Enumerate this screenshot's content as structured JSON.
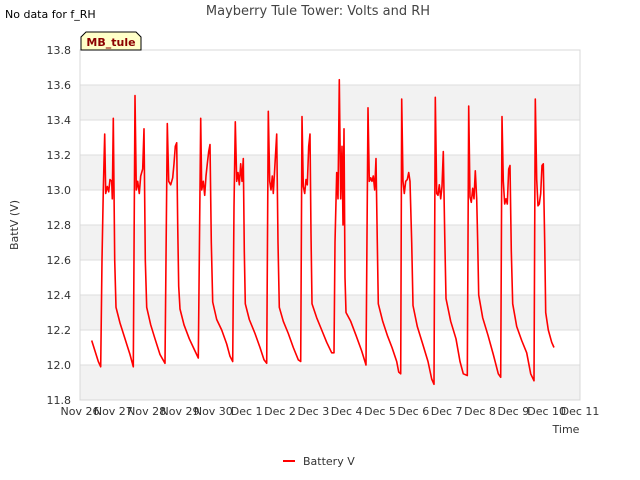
{
  "note": "No data for f_RH",
  "badge": "MB_tule",
  "colors": {
    "series": "#ff0000",
    "badge_fill": "#ffffc8",
    "band": "#f2f2f2"
  },
  "chart_data": {
    "type": "line",
    "title": "Mayberry Tule Tower: Volts and RH",
    "xlabel": "Time",
    "ylabel": "BattV (V)",
    "ylim": [
      11.8,
      13.8
    ],
    "xlim": [
      0,
      15
    ],
    "x_ticks": [
      {
        "x": 0,
        "label": "Nov 26"
      },
      {
        "x": 1,
        "label": "Nov 27"
      },
      {
        "x": 2,
        "label": "Nov 28"
      },
      {
        "x": 3,
        "label": "Nov 29"
      },
      {
        "x": 4,
        "label": "Nov 30"
      },
      {
        "x": 5,
        "label": "Dec 1"
      },
      {
        "x": 6,
        "label": "Dec 2"
      },
      {
        "x": 7,
        "label": "Dec 3"
      },
      {
        "x": 8,
        "label": "Dec 4"
      },
      {
        "x": 9,
        "label": "Dec 5"
      },
      {
        "x": 10,
        "label": "Dec 6"
      },
      {
        "x": 11,
        "label": "Dec 7"
      },
      {
        "x": 12,
        "label": "Dec 8"
      },
      {
        "x": 13,
        "label": "Dec 9"
      },
      {
        "x": 14,
        "label": "Dec 10"
      },
      {
        "x": 15,
        "label": "Dec 11"
      }
    ],
    "y_ticks": [
      11.8,
      12.0,
      12.2,
      12.4,
      12.6,
      12.8,
      13.0,
      13.2,
      13.4,
      13.6,
      13.8
    ],
    "legend": "bottom-center",
    "series": [
      {
        "name": "Battery V",
        "color": "#ff0000",
        "points": [
          [
            0.35,
            12.14
          ],
          [
            0.45,
            12.08
          ],
          [
            0.55,
            12.02
          ],
          [
            0.62,
            11.99
          ],
          [
            0.66,
            12.6
          ],
          [
            0.7,
            13.0
          ],
          [
            0.74,
            13.32
          ],
          [
            0.77,
            12.98
          ],
          [
            0.82,
            13.02
          ],
          [
            0.86,
            12.99
          ],
          [
            0.9,
            13.06
          ],
          [
            0.95,
            13.05
          ],
          [
            0.97,
            12.95
          ],
          [
            1.0,
            13.41
          ],
          [
            1.04,
            12.6
          ],
          [
            1.08,
            12.33
          ],
          [
            1.2,
            12.24
          ],
          [
            1.35,
            12.15
          ],
          [
            1.5,
            12.06
          ],
          [
            1.6,
            11.99
          ],
          [
            1.65,
            13.54
          ],
          [
            1.69,
            13.0
          ],
          [
            1.73,
            13.05
          ],
          [
            1.78,
            12.98
          ],
          [
            1.82,
            13.08
          ],
          [
            1.88,
            13.12
          ],
          [
            1.92,
            13.35
          ],
          [
            1.96,
            12.6
          ],
          [
            2.0,
            12.33
          ],
          [
            2.12,
            12.23
          ],
          [
            2.25,
            12.15
          ],
          [
            2.4,
            12.06
          ],
          [
            2.55,
            12.01
          ],
          [
            2.62,
            13.38
          ],
          [
            2.66,
            13.05
          ],
          [
            2.72,
            13.03
          ],
          [
            2.78,
            13.07
          ],
          [
            2.82,
            13.15
          ],
          [
            2.86,
            13.25
          ],
          [
            2.9,
            13.27
          ],
          [
            2.93,
            12.8
          ],
          [
            2.96,
            12.45
          ],
          [
            3.0,
            12.32
          ],
          [
            3.12,
            12.23
          ],
          [
            3.28,
            12.15
          ],
          [
            3.45,
            12.08
          ],
          [
            3.55,
            12.04
          ],
          [
            3.62,
            13.41
          ],
          [
            3.65,
            13.0
          ],
          [
            3.7,
            13.05
          ],
          [
            3.74,
            12.97
          ],
          [
            3.78,
            13.08
          ],
          [
            3.82,
            13.15
          ],
          [
            3.86,
            13.22
          ],
          [
            3.9,
            13.26
          ],
          [
            3.94,
            12.7
          ],
          [
            3.98,
            12.36
          ],
          [
            4.1,
            12.26
          ],
          [
            4.25,
            12.2
          ],
          [
            4.4,
            12.12
          ],
          [
            4.5,
            12.05
          ],
          [
            4.58,
            12.02
          ],
          [
            4.62,
            12.9
          ],
          [
            4.66,
            13.39
          ],
          [
            4.7,
            13.05
          ],
          [
            4.74,
            13.1
          ],
          [
            4.78,
            13.03
          ],
          [
            4.82,
            13.15
          ],
          [
            4.86,
            13.05
          ],
          [
            4.9,
            13.18
          ],
          [
            4.93,
            12.65
          ],
          [
            4.96,
            12.35
          ],
          [
            5.08,
            12.26
          ],
          [
            5.25,
            12.18
          ],
          [
            5.4,
            12.1
          ],
          [
            5.52,
            12.03
          ],
          [
            5.6,
            12.01
          ],
          [
            5.65,
            13.45
          ],
          [
            5.69,
            13.05
          ],
          [
            5.73,
            13.0
          ],
          [
            5.77,
            13.08
          ],
          [
            5.8,
            12.98
          ],
          [
            5.85,
            13.15
          ],
          [
            5.9,
            13.32
          ],
          [
            5.94,
            12.7
          ],
          [
            5.98,
            12.33
          ],
          [
            6.1,
            12.25
          ],
          [
            6.25,
            12.18
          ],
          [
            6.4,
            12.1
          ],
          [
            6.55,
            12.03
          ],
          [
            6.62,
            12.02
          ],
          [
            6.66,
            13.42
          ],
          [
            6.7,
            13.02
          ],
          [
            6.74,
            12.98
          ],
          [
            6.78,
            13.06
          ],
          [
            6.82,
            13.03
          ],
          [
            6.86,
            13.25
          ],
          [
            6.9,
            13.32
          ],
          [
            6.93,
            12.75
          ],
          [
            6.96,
            12.35
          ],
          [
            7.1,
            12.27
          ],
          [
            7.25,
            12.2
          ],
          [
            7.4,
            12.13
          ],
          [
            7.55,
            12.07
          ],
          [
            7.62,
            12.07
          ],
          [
            7.65,
            12.7
          ],
          [
            7.7,
            13.1
          ],
          [
            7.74,
            12.95
          ],
          [
            7.78,
            13.63
          ],
          [
            7.82,
            12.95
          ],
          [
            7.86,
            13.25
          ],
          [
            7.89,
            12.8
          ],
          [
            7.92,
            13.35
          ],
          [
            7.95,
            12.5
          ],
          [
            7.98,
            12.3
          ],
          [
            8.12,
            12.25
          ],
          [
            8.28,
            12.17
          ],
          [
            8.45,
            12.08
          ],
          [
            8.58,
            12.0
          ],
          [
            8.64,
            13.47
          ],
          [
            8.68,
            13.05
          ],
          [
            8.72,
            13.07
          ],
          [
            8.76,
            13.05
          ],
          [
            8.8,
            13.08
          ],
          [
            8.84,
            13.0
          ],
          [
            8.88,
            13.18
          ],
          [
            8.92,
            12.7
          ],
          [
            8.95,
            12.35
          ],
          [
            9.08,
            12.25
          ],
          [
            9.22,
            12.17
          ],
          [
            9.36,
            12.1
          ],
          [
            9.5,
            12.02
          ],
          [
            9.56,
            11.96
          ],
          [
            9.62,
            11.95
          ],
          [
            9.65,
            13.52
          ],
          [
            9.69,
            13.05
          ],
          [
            9.73,
            12.98
          ],
          [
            9.77,
            13.05
          ],
          [
            9.82,
            13.06
          ],
          [
            9.86,
            13.1
          ],
          [
            9.9,
            13.05
          ],
          [
            9.95,
            12.7
          ],
          [
            9.99,
            12.34
          ],
          [
            10.12,
            12.22
          ],
          [
            10.28,
            12.12
          ],
          [
            10.44,
            12.02
          ],
          [
            10.55,
            11.92
          ],
          [
            10.62,
            11.89
          ],
          [
            10.66,
            13.53
          ],
          [
            10.7,
            12.98
          ],
          [
            10.74,
            12.97
          ],
          [
            10.78,
            13.03
          ],
          [
            10.82,
            12.95
          ],
          [
            10.86,
            13.02
          ],
          [
            10.9,
            13.22
          ],
          [
            10.94,
            12.75
          ],
          [
            10.98,
            12.38
          ],
          [
            11.12,
            12.25
          ],
          [
            11.28,
            12.15
          ],
          [
            11.4,
            12.02
          ],
          [
            11.5,
            11.95
          ],
          [
            11.62,
            11.94
          ],
          [
            11.66,
            13.48
          ],
          [
            11.7,
            12.96
          ],
          [
            11.74,
            12.93
          ],
          [
            11.78,
            13.01
          ],
          [
            11.82,
            12.95
          ],
          [
            11.86,
            13.11
          ],
          [
            11.9,
            12.95
          ],
          [
            11.93,
            12.7
          ],
          [
            11.96,
            12.4
          ],
          [
            12.08,
            12.27
          ],
          [
            12.24,
            12.17
          ],
          [
            12.4,
            12.06
          ],
          [
            12.55,
            11.95
          ],
          [
            12.62,
            11.93
          ],
          [
            12.66,
            13.42
          ],
          [
            12.7,
            13.05
          ],
          [
            12.74,
            12.92
          ],
          [
            12.78,
            12.95
          ],
          [
            12.82,
            12.92
          ],
          [
            12.86,
            13.12
          ],
          [
            12.9,
            13.14
          ],
          [
            12.94,
            12.65
          ],
          [
            12.98,
            12.35
          ],
          [
            13.1,
            12.22
          ],
          [
            13.25,
            12.14
          ],
          [
            13.4,
            12.07
          ],
          [
            13.52,
            11.95
          ],
          [
            13.62,
            11.91
          ],
          [
            13.66,
            13.52
          ],
          [
            13.7,
            13.06
          ],
          [
            13.74,
            12.91
          ],
          [
            13.78,
            12.92
          ],
          [
            13.82,
            12.98
          ],
          [
            13.86,
            13.14
          ],
          [
            13.9,
            13.15
          ],
          [
            13.94,
            12.7
          ],
          [
            13.97,
            12.3
          ],
          [
            14.05,
            12.2
          ],
          [
            14.15,
            12.13
          ],
          [
            14.22,
            12.1
          ]
        ]
      }
    ]
  }
}
